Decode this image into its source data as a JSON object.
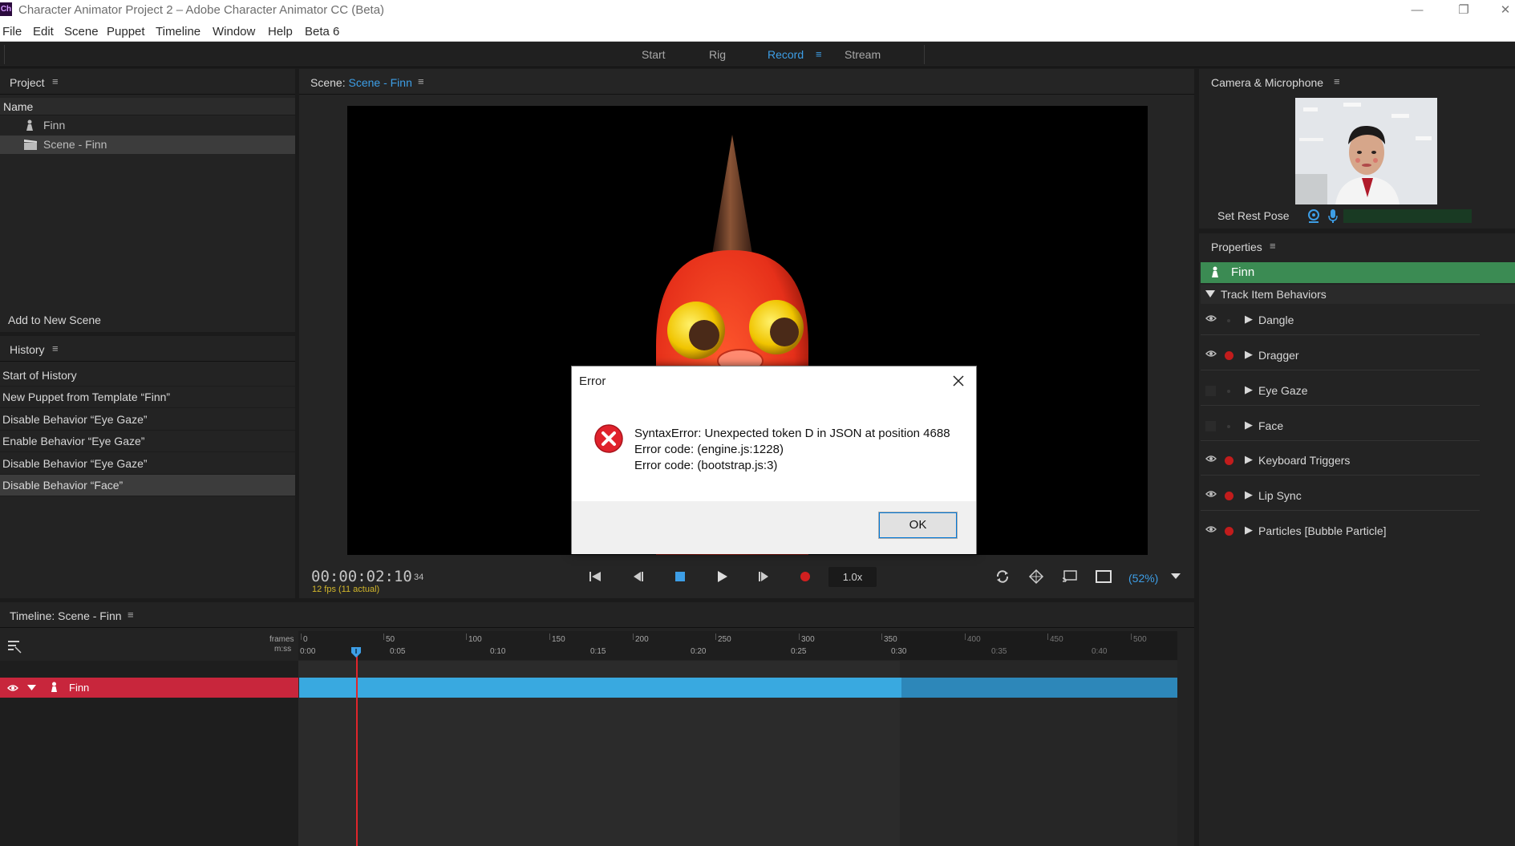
{
  "window": {
    "title": "Character Animator Project 2 – Adobe Character Animator CC (Beta)",
    "app_icon_text": "Ch",
    "controls": {
      "minimize": "—",
      "restore": "❐",
      "close": "✕"
    }
  },
  "menu": {
    "items": [
      "File",
      "Edit",
      "Scene",
      "Puppet",
      "Timeline",
      "Window",
      "Help",
      "Beta 6"
    ]
  },
  "workspace": {
    "tabs": [
      "Start",
      "Rig",
      "Record",
      "Stream"
    ],
    "active": "Record",
    "accent_color": "#3d9ee6"
  },
  "project": {
    "title": "Project",
    "column_name": "Name",
    "items": [
      {
        "label": "Finn",
        "icon": "puppet-icon",
        "selected": false
      },
      {
        "label": "Scene - Finn",
        "icon": "scene-icon",
        "selected": true
      }
    ],
    "add_to_scene": "Add to New Scene"
  },
  "history": {
    "title": "History",
    "items": [
      "Start of History",
      "New Puppet from Template “Finn”",
      "Disable Behavior “Eye Gaze”",
      "Enable Behavior “Eye Gaze”",
      "Disable Behavior “Eye Gaze”",
      "Disable Behavior “Face”"
    ],
    "selected_index": 5
  },
  "scene": {
    "title_prefix": "Scene:",
    "title_name": "Scene - Finn",
    "timecode": "00:00:02:10",
    "fps_text": "12 fps (11 actual)",
    "frame": "34",
    "speed": "1.0x",
    "zoom": "(52%)"
  },
  "camera": {
    "title": "Camera & Microphone",
    "set_rest_pose": "Set Rest Pose"
  },
  "properties": {
    "title": "Properties",
    "puppet": "Finn",
    "section": "Track Item Behaviors",
    "behaviors": [
      {
        "label": "Dangle",
        "visible": true,
        "record": false
      },
      {
        "label": "Dragger",
        "visible": true,
        "record": true
      },
      {
        "label": "Eye Gaze",
        "visible": false,
        "record": false
      },
      {
        "label": "Face",
        "visible": false,
        "record": false
      },
      {
        "label": "Keyboard Triggers",
        "visible": true,
        "record": true
      },
      {
        "label": "Lip Sync",
        "visible": true,
        "record": true
      },
      {
        "label": "Particles [Bubble Particle]",
        "visible": true,
        "record": true
      }
    ]
  },
  "timeline": {
    "title": "Timeline: Scene - Finn",
    "frames_label": "frames",
    "mss_label": "m:ss",
    "frame_ticks": [
      "0",
      "50",
      "100",
      "150",
      "200",
      "250",
      "300",
      "350",
      "400",
      "450",
      "500"
    ],
    "time_ticks": [
      "0:00",
      "0:05",
      "0:10",
      "0:15",
      "0:20",
      "0:25",
      "0:30",
      "0:35",
      "0:40"
    ],
    "track_name": "Finn",
    "track_color": "#c8263c",
    "bar_color": "#39a9e0"
  },
  "dialog": {
    "title": "Error",
    "lines": [
      "SyntaxError: Unexpected token D in JSON at position 4688",
      "Error code: (engine.js:1228)",
      "Error code: (bootstrap.js:3)"
    ],
    "ok_label": "OK",
    "icon": "error-icon"
  }
}
